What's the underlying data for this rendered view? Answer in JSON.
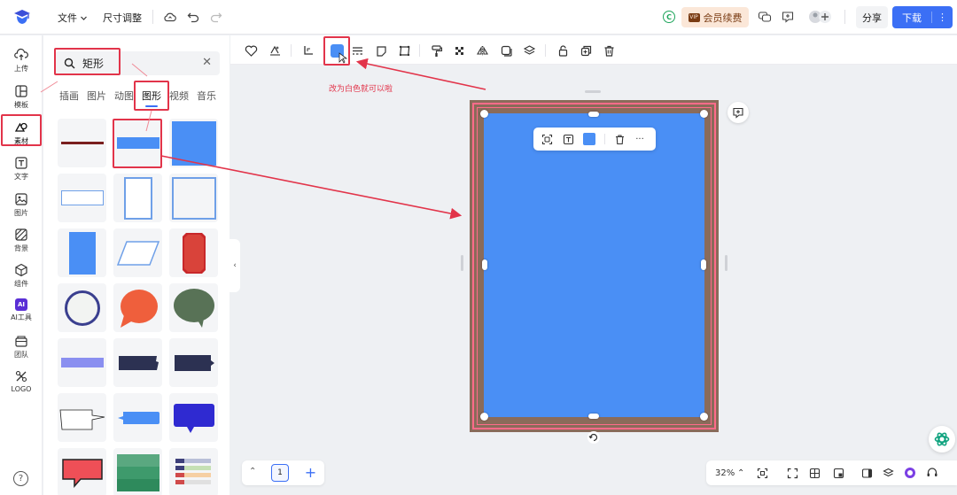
{
  "topbar": {
    "menu_file": "文件",
    "menu_size": "尺寸调整",
    "vip_label": "会员续费",
    "vip_mark": "VIP",
    "share": "分享",
    "download": "下载",
    "more": "⋮",
    "coin": "C"
  },
  "rail": {
    "items": [
      {
        "label": "上传",
        "icon": "upload-icon"
      },
      {
        "label": "模板",
        "icon": "template-icon"
      },
      {
        "label": "素材",
        "icon": "shapes-icon"
      },
      {
        "label": "文字",
        "icon": "text-icon"
      },
      {
        "label": "图片",
        "icon": "image-icon"
      },
      {
        "label": "背景",
        "icon": "background-icon"
      },
      {
        "label": "组件",
        "icon": "component-icon"
      },
      {
        "label": "AI工具",
        "icon": "ai-icon"
      },
      {
        "label": "团队",
        "icon": "team-icon"
      },
      {
        "label": "LOGO",
        "icon": "logo-icon"
      }
    ],
    "ai_badge": "AI",
    "help": "?"
  },
  "panel": {
    "search_value": "矩形",
    "clear": "✕",
    "tabs": [
      "插画",
      "图片",
      "动图",
      "图形",
      "视频",
      "音乐"
    ],
    "active_tab": "图形",
    "collapse": "‹"
  },
  "annotation": {
    "note": "改为白色就可以啦"
  },
  "colors": {
    "accent": "#3b6ff5",
    "shape_fill": "#4a8ff5",
    "page_bg": "#8a6b5a",
    "annotation": "#e2344a"
  },
  "float_bar": {
    "more": "···"
  },
  "bottom": {
    "page_up": "⌃",
    "page_number": "1",
    "add_page": "+",
    "zoom": "32%",
    "zoom_caret": "⌃"
  }
}
